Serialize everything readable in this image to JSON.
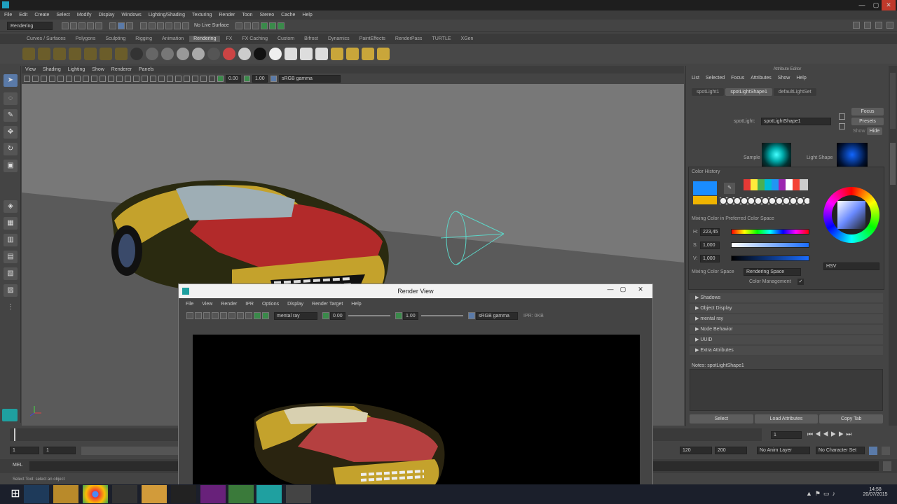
{
  "window": {
    "minimize": "—",
    "maximize": "▢",
    "close": "✕"
  },
  "menubar": [
    "File",
    "Edit",
    "Create",
    "Select",
    "Modify",
    "Display",
    "Windows",
    "Lighting/Shading",
    "Texturing",
    "Render",
    "Toon",
    "Stereo",
    "Cache",
    "Help"
  ],
  "statusline": {
    "menuset": "Rendering",
    "live_surface": "No Live Surface"
  },
  "shelf_tabs": [
    "Curves / Surfaces",
    "Polygons",
    "Sculpting",
    "Rigging",
    "Animation",
    "Rendering",
    "FX",
    "FX Caching",
    "Custom",
    "Bifrost",
    "Dynamics",
    "PaintEffects",
    "RenderPass",
    "TURTLE",
    "XGen"
  ],
  "shelf_active": "Rendering",
  "viewport": {
    "menu": [
      "View",
      "Shading",
      "Lighting",
      "Show",
      "Renderer",
      "Panels"
    ],
    "field1": "0.00",
    "field2": "1.00",
    "colorspace": "sRGB gamma"
  },
  "attribute_editor": {
    "title": "Attribute Editor",
    "menu": [
      "List",
      "Selected",
      "Focus",
      "Attributes",
      "Show",
      "Help"
    ],
    "tabs": [
      "spotLight1",
      "spotLightShape1",
      "defaultLightSet"
    ],
    "active_tab": "spotLightShape1",
    "node_label": "spotLight:",
    "node_value": "spotLightShape1",
    "focus": "Focus",
    "presets": "Presets",
    "show": "Show",
    "hide": "Hide",
    "sample_label": "Sample",
    "light_shape_label": "Light Shape",
    "frames": [
      "Shadows",
      "Object Display",
      "mental ray",
      "Node Behavior",
      "UUID",
      "Extra Attributes"
    ],
    "notes_label": "Notes:",
    "notes_value": "spotLightShape1",
    "buttons": [
      "Select",
      "Load Attributes",
      "Copy Tab"
    ]
  },
  "color_chooser": {
    "history_label": "Color History",
    "mixing_label": "Mixing Color in Preferred Color Space",
    "h_label": "H:",
    "h_value": "223,45",
    "s_label": "S:",
    "s_value": "1,000",
    "v_label": "V:",
    "v_value": "1,000",
    "mixing_space_label": "Mixing Color Space",
    "mixing_space_value": "Rendering Space",
    "color_management_label": "Color Management",
    "color_management_check": "✓",
    "mode": "HSV",
    "history_swatches": [
      "#e53935",
      "#ffeb3b",
      "#4caf50",
      "#00bcd4",
      "#2196f3",
      "#9c27b0",
      "#f44336",
      "#ffffff"
    ]
  },
  "timeline": {
    "start": "1",
    "start2": "1",
    "current": "1",
    "end1": "120",
    "end2": "200",
    "anim_layer": "No Anim Layer",
    "char_set": "No Character Set",
    "mel_label": "MEL",
    "help_text": "Select Tool: select an object"
  },
  "render_view": {
    "title": "Render View",
    "menu": [
      "File",
      "View",
      "Render",
      "IPR",
      "Options",
      "Display",
      "Render Target",
      "Help"
    ],
    "renderer": "mental ray",
    "field1": "0.00",
    "field2": "1.00",
    "colorspace": "sRGB gamma",
    "ipr": "IPR: 0KB"
  },
  "taskbar": {
    "time": "14:58",
    "date": "20/07/2015"
  },
  "colors": {
    "accent": "#5cd6c8",
    "car_yellow": "#c4a22c",
    "car_red": "#b22a2a"
  }
}
